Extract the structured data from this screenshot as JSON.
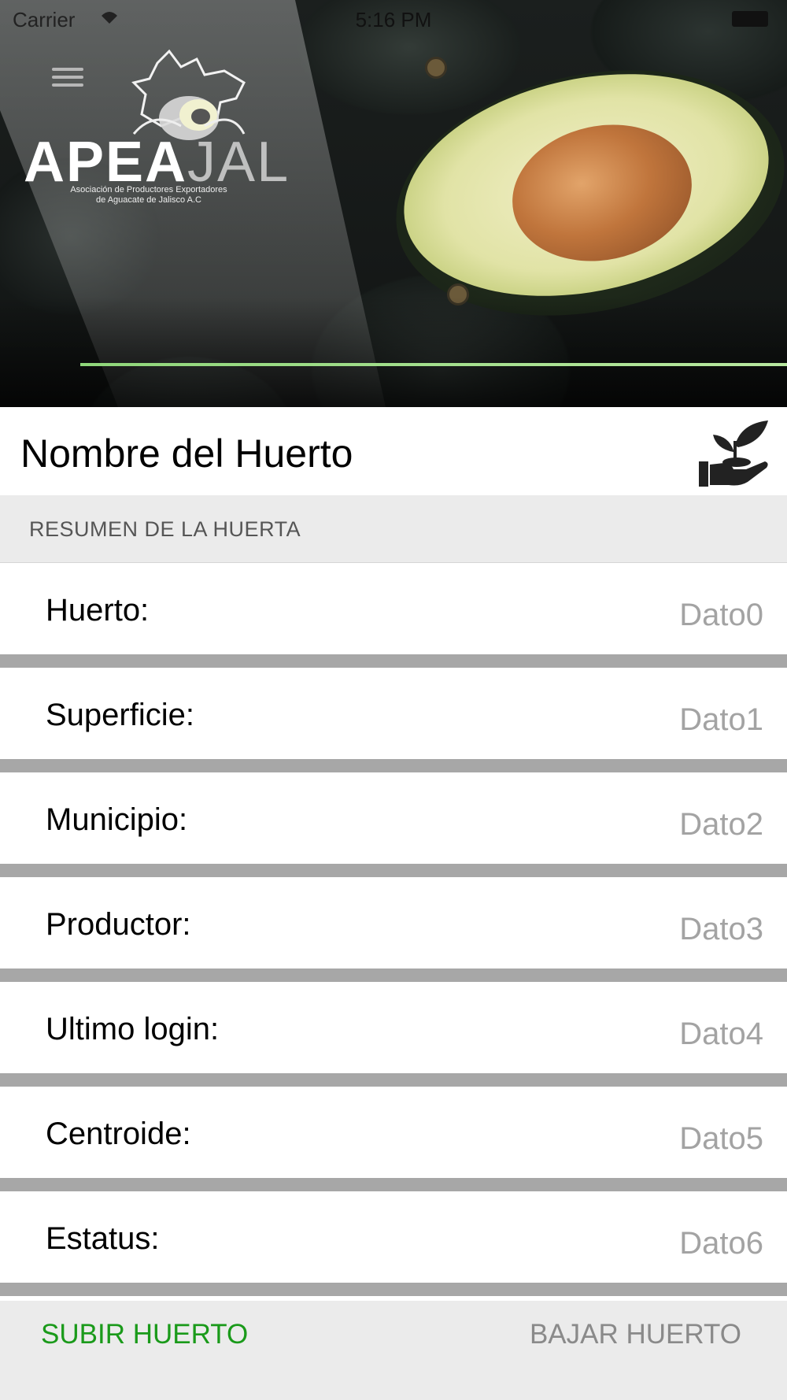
{
  "status_bar": {
    "carrier": "Carrier",
    "time": "5:16 PM"
  },
  "header": {
    "logo": {
      "word_main": "APEA",
      "word_alt": "JAL",
      "subtitle_line1": "Asociación de Productores Exportadores",
      "subtitle_line2": "de Aguacate de Jalisco A.C"
    }
  },
  "title": "Nombre del Huerto",
  "section": {
    "label": "RESUMEN DE LA HUERTA"
  },
  "details": [
    {
      "label": "Huerto:",
      "value": "Dato0"
    },
    {
      "label": "Superficie:",
      "value": "Dato1"
    },
    {
      "label": "Municipio:",
      "value": "Dato2"
    },
    {
      "label": "Productor:",
      "value": "Dato3"
    },
    {
      "label": "Ultimo login:",
      "value": "Dato4"
    },
    {
      "label": "Centroide:",
      "value": "Dato5"
    },
    {
      "label": "Estatus:",
      "value": "Dato6"
    }
  ],
  "actions": {
    "upload_label": "SUBIR HUERTO",
    "download_label": "BAJAR HUERTO"
  },
  "colors": {
    "upload": "#1a9a1a",
    "download": "#8a8a8a",
    "accent_line": "#8fd67a"
  },
  "icons": {
    "menu": "hamburger-icon",
    "plant": "plant-in-hand-icon"
  }
}
